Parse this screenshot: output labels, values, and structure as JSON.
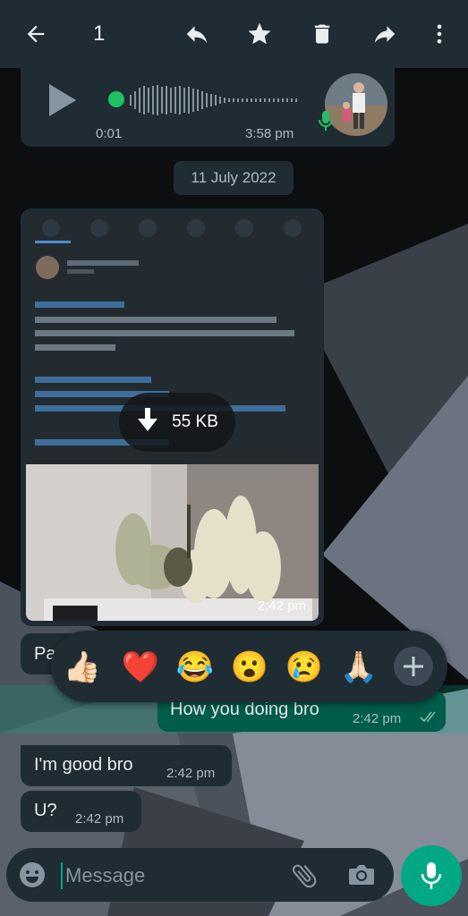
{
  "header": {
    "selected_count": "1",
    "icons": [
      "back-arrow-icon",
      "reply-icon",
      "star-icon",
      "delete-icon",
      "forward-icon",
      "more-vert-icon"
    ]
  },
  "voice_message": {
    "duration": "0:01",
    "time": "3:58 pm"
  },
  "date_chip": "11 July 2022",
  "image_message": {
    "size_label": "55 KB",
    "time": "2:42 pm"
  },
  "partial_message": {
    "text": "Pa"
  },
  "reactions": [
    "👍🏻",
    "❤️",
    "😂",
    "😮",
    "😢",
    "🙏🏻"
  ],
  "messages": [
    {
      "direction": "out",
      "text": "How you doing bro",
      "time": "2:42 pm"
    },
    {
      "direction": "in",
      "text": "I'm good bro",
      "time": "2:42 pm"
    },
    {
      "direction": "in",
      "text": "U?",
      "time": "2:42 pm"
    }
  ],
  "composer": {
    "placeholder": "Message"
  },
  "colors": {
    "header_bg": "#1f2c34",
    "bubble_in": "#1f2c34",
    "bubble_out": "#005c4b",
    "accent": "#00a884"
  }
}
